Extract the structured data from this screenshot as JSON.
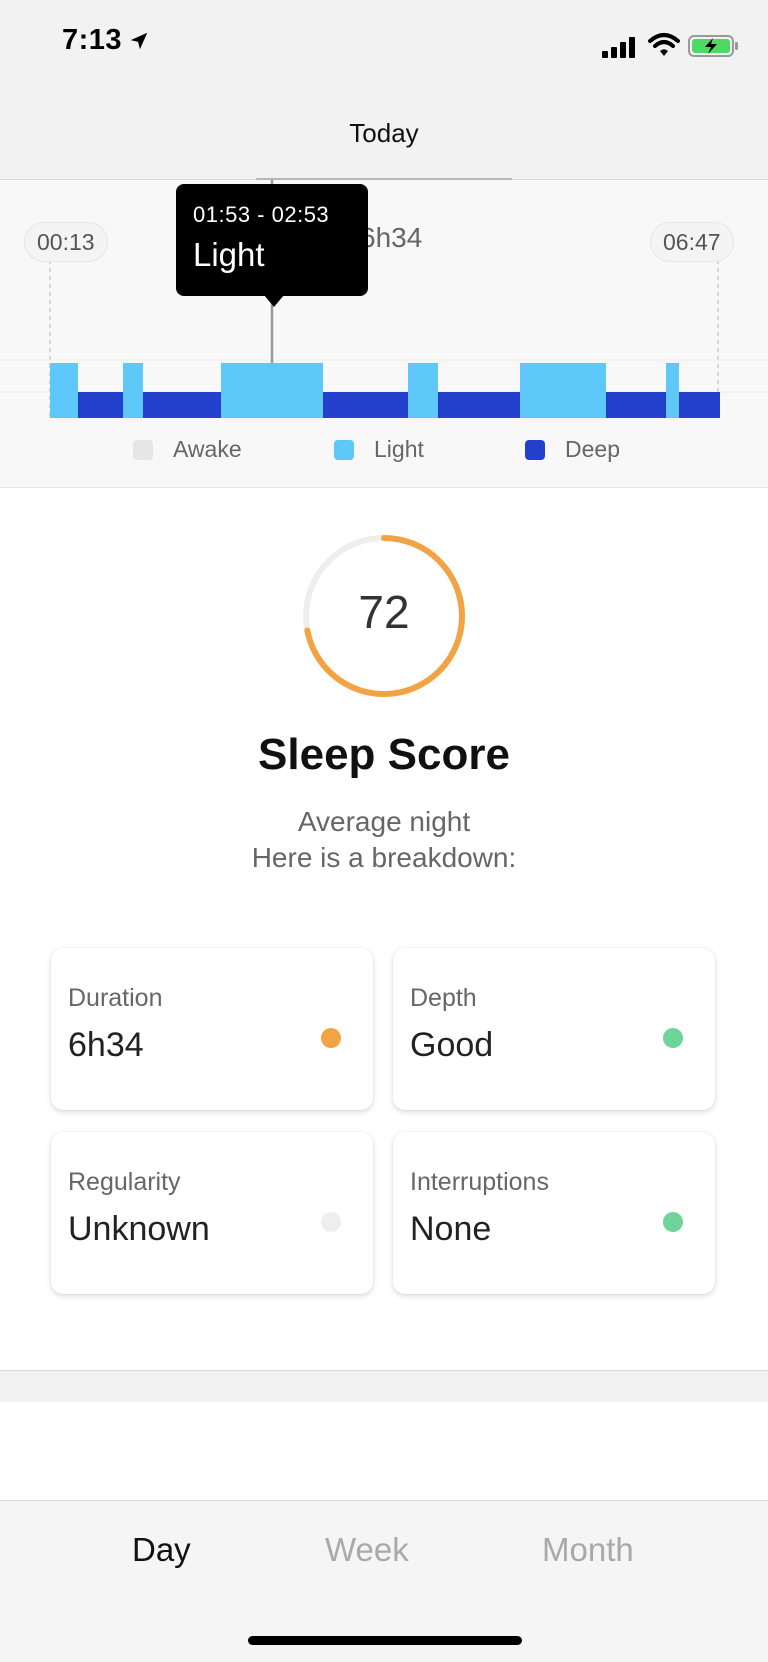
{
  "status_bar": {
    "time": "7:13",
    "icons": [
      "location-arrow-icon",
      "cellular-signal-icon",
      "wifi-icon",
      "battery-charging-icon"
    ]
  },
  "header": {
    "title": "Today"
  },
  "sleep_chart": {
    "start_time": "00:13",
    "end_time": "06:47",
    "total_duration": "6h34",
    "tooltip": {
      "range": "01:53 - 02:53",
      "stage": "Light"
    },
    "legend": [
      {
        "label": "Awake",
        "color": "#e6e6e6"
      },
      {
        "label": "Light",
        "color": "#5ec8f8"
      },
      {
        "label": "Deep",
        "color": "#2240cc"
      }
    ]
  },
  "score": {
    "value": "72",
    "progress": 0.72,
    "ring_color": "#f2a444",
    "track_color": "#eeeeee",
    "title": "Sleep Score",
    "subtitle_line1": "Average night",
    "subtitle_line2": "Here is a breakdown:"
  },
  "breakdown": [
    {
      "label": "Duration",
      "value": "6h34",
      "status_color": "#f2a444"
    },
    {
      "label": "Depth",
      "value": "Good",
      "status_color": "#6fd49a"
    },
    {
      "label": "Regularity",
      "value": "Unknown",
      "status_color": "#eeeeee"
    },
    {
      "label": "Interruptions",
      "value": "None",
      "status_color": "#6fd49a"
    }
  ],
  "tabs": [
    {
      "label": "Day",
      "active": true
    },
    {
      "label": "Week",
      "active": false
    },
    {
      "label": "Month",
      "active": false
    }
  ]
}
